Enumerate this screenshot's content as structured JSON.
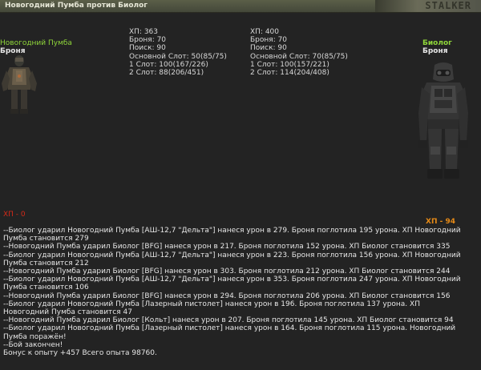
{
  "title_bar": {
    "title": "Новогодний Пумба против Биолог",
    "logo_text": "STALKER"
  },
  "left_fighter": {
    "name": "Новогодний Пумба",
    "armor_label": "Броня",
    "hp_status": "ХП - 0",
    "stats": [
      "ХП: 363",
      "Броня: 70",
      "Поиск: 90",
      "Основной Слот: 50(85/75)",
      "1 Слот: 100(167/226)",
      "2 Слот: 88(206/451)"
    ]
  },
  "right_fighter": {
    "name": "Биолог",
    "armor_label": "Броня",
    "hp_status": "ХП - 94",
    "stats": [
      "ХП: 400",
      "Броня: 70",
      "Поиск: 90",
      "Основной Слот: 70(85/75)",
      "1 Слот: 100(157/221)",
      "2 Слот: 114(204/408)"
    ]
  },
  "colors": {
    "name": "#8fd63a",
    "hp_dead": "#d42a18",
    "hp_alive": "#e68a17",
    "text": "#e6e6e6",
    "background": "#232323"
  },
  "battle_log": [
    "--Биолог ударил Новогодний Пумба [АШ-12,7 \"Дельта\"] нанеся урон в 279. Броня поглотила 195 урона. ХП Новогодний Пумба становится 279",
    "--Новогодний Пумба ударил Биолог [BFG] нанеся урон в 217. Броня поглотила 152 урона. ХП Биолог становится 335",
    "--Биолог ударил Новогодний Пумба [АШ-12,7 \"Дельта\"] нанеся урон в 223. Броня поглотила 156 урона. ХП Новогодний Пумба становится 212",
    "--Новогодний Пумба ударил Биолог [BFG] нанеся урон в 303. Броня поглотила 212 урона. ХП Биолог становится 244",
    "--Биолог ударил Новогодний Пумба [АШ-12,7 \"Дельта\"] нанеся урон в 353. Броня поглотила 247 урона. ХП Новогодний Пумба становится 106",
    "--Новогодний Пумба ударил Биолог [BFG] нанеся урон в 294. Броня поглотила 206 урона. ХП Биолог становится 156",
    "--Биолог ударил Новогодний Пумба [Лазерный пистолет] нанеся урон в 196. Броня поглотила 137 урона. ХП Новогодний Пумба становится 47",
    "--Новогодний Пумба ударил Биолог [Кольт] нанеся урон в 207. Броня поглотила 145 урона. ХП Биолог становится 94",
    "--Биолог ударил Новогодний Пумба [Лазерный пистолет] нанеся урон в 164. Броня поглотила 115 урона. Новогодний Пумба поражён!",
    "--Бой закончен!",
    "Бонус к опыту +457 Всего опыта 98760."
  ]
}
